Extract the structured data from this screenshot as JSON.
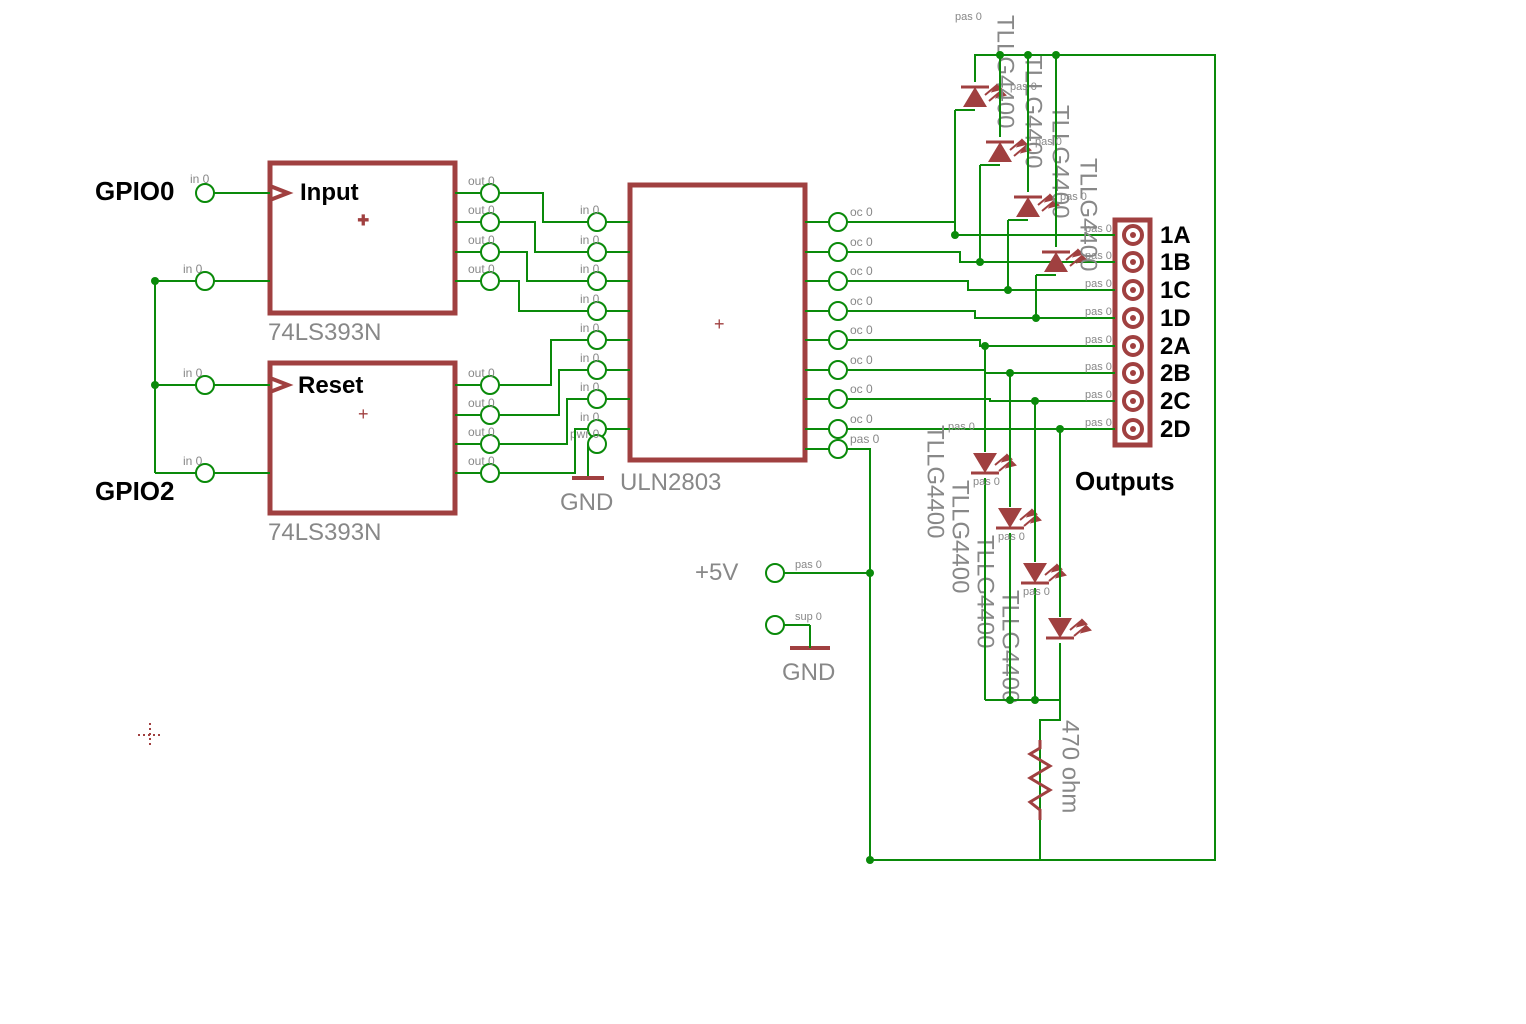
{
  "signals": {
    "gpio0": "GPIO0",
    "gpio2": "GPIO2",
    "input": "Input",
    "reset": "Reset",
    "outputs_header": "Outputs"
  },
  "components": {
    "u1a": {
      "part": "74LS393N"
    },
    "u1b": {
      "part": "74LS393N"
    },
    "u2": {
      "part": "ULN2803"
    },
    "r1": {
      "value": "470 ohm"
    },
    "leds": [
      "TLLG4400",
      "TLLG4400",
      "TLLG4400",
      "TLLG4400",
      "TLLG4400",
      "TLLG4400",
      "TLLG4400",
      "TLLG4400"
    ]
  },
  "power": {
    "v5": "+5V",
    "gnd": "GND"
  },
  "outputs": [
    "1A",
    "1B",
    "1C",
    "1D",
    "2A",
    "2B",
    "2C",
    "2D"
  ],
  "pin_markers": {
    "in": "in 0",
    "out": "out 0",
    "pwr": "pwr 0",
    "sup": "sup 0",
    "oc": "oc 0",
    "pas": "pas 0"
  }
}
